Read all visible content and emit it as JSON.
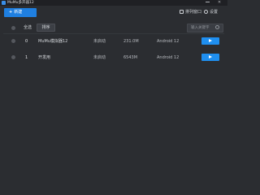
{
  "window": {
    "title": "MuMu多开器12"
  },
  "toolbar": {
    "new_label": "新建",
    "arrange_label": "排列窗口",
    "settings_label": "设置"
  },
  "filter": {
    "select_all_label": "全选",
    "sort_label": "排序",
    "search_placeholder": "输入关键字"
  },
  "rows": [
    {
      "index": "0",
      "name": "MuMu模拟器12",
      "status": "未启动",
      "size": "231.0M",
      "android": "Android 12"
    },
    {
      "index": "1",
      "name": "开发用",
      "status": "未启动",
      "size": "6543M",
      "android": "Android 12"
    }
  ],
  "icons": {
    "app": "app-logo-icon",
    "minimize": "minimize-icon",
    "close": "close-icon",
    "arrange": "arrange-window-icon",
    "settings": "gear-icon",
    "search": "search-icon",
    "play": "play-icon"
  },
  "colors": {
    "accent": "#1f8ff0",
    "background": "#2b2d31",
    "titlebar": "#1f2024"
  }
}
